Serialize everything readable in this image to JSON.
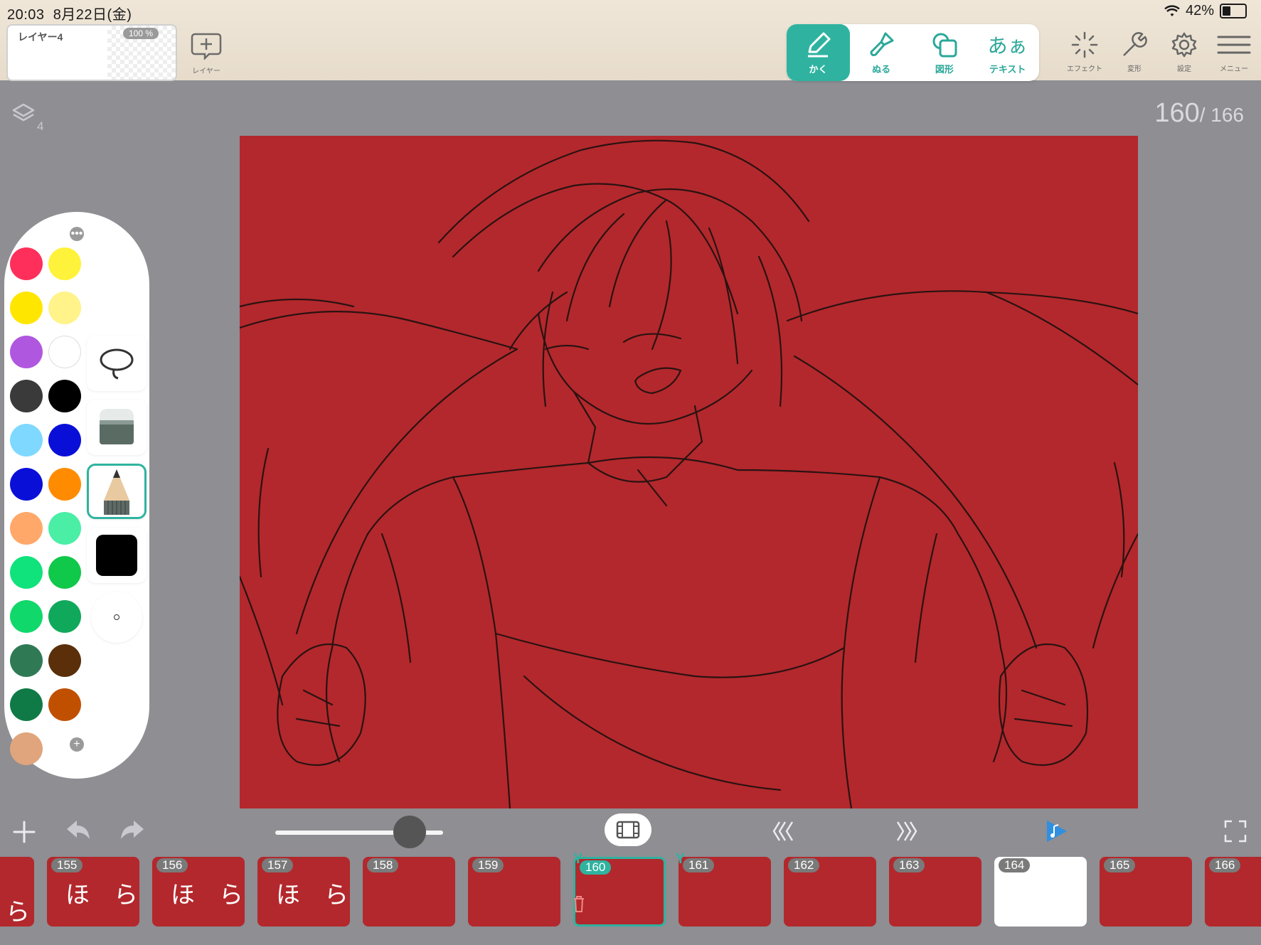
{
  "status": {
    "time": "20:03",
    "date": "8月22日(金)",
    "battery": "42%",
    "battery_level": 0.42
  },
  "layer_card": {
    "name": "レイヤー4",
    "opacity": "100 %"
  },
  "add_layer": {
    "label": "レイヤー"
  },
  "tools": [
    {
      "label": "かく",
      "icon": "pen-icon",
      "active": true
    },
    {
      "label": "ぬる",
      "icon": "brush-icon",
      "active": false
    },
    {
      "label": "図形",
      "icon": "shape-icon",
      "active": false
    },
    {
      "label": "テキスト",
      "icon": "text-icon",
      "glyph": "あぁ",
      "active": false
    }
  ],
  "right_tools": [
    {
      "label": "エフェクト",
      "icon": "effect-sparkle-icon"
    },
    {
      "label": "変形",
      "icon": "wrench-icon"
    },
    {
      "label": "設定",
      "icon": "gear-icon"
    },
    {
      "label": "メニュー",
      "icon": "hamburger-menu-icon"
    }
  ],
  "layers_indicator": {
    "count": "4"
  },
  "frame_counter": {
    "current": "160",
    "total": "/ 166"
  },
  "canvas": {
    "background": "#b3282c"
  },
  "palette": {
    "colors_left": [
      "#fe2f5a",
      "#ffe600",
      "#b057e0",
      "#3a3a3a",
      "#7fd8ff",
      "#0a0fd8",
      "#ffa86a",
      "#10e27c",
      "#10d86a",
      "#2f7a55",
      "#0f7a45",
      "#e0a57c"
    ],
    "colors_right": [
      "#fff23a",
      "#fff38a",
      "#ffffff",
      "#000000",
      "#0a0fd8",
      "#ff8c00",
      "#4aeea5",
      "#10c84a",
      "#10a85a",
      "#5a2f0a",
      "#c05000"
    ],
    "current_color": "#000000"
  },
  "film": {
    "frames": [
      {
        "num": "",
        "glyph": "ら",
        "type": "red"
      },
      {
        "num": "155",
        "glyph": "ほ　ら",
        "type": "red"
      },
      {
        "num": "156",
        "glyph": "ほ　ら",
        "type": "red"
      },
      {
        "num": "157",
        "glyph": "ほ　ら",
        "type": "red"
      },
      {
        "num": "158",
        "glyph": "",
        "type": "red"
      },
      {
        "num": "159",
        "glyph": "",
        "type": "red"
      },
      {
        "num": "160",
        "glyph": "",
        "type": "active"
      },
      {
        "num": "161",
        "glyph": "",
        "type": "red"
      },
      {
        "num": "162",
        "glyph": "",
        "type": "red"
      },
      {
        "num": "163",
        "glyph": "",
        "type": "red"
      },
      {
        "num": "164",
        "glyph": "",
        "type": "white"
      },
      {
        "num": "165",
        "glyph": "",
        "type": "red"
      },
      {
        "num": "166",
        "glyph": "",
        "type": "red"
      }
    ],
    "playback_speed": 0.8
  }
}
